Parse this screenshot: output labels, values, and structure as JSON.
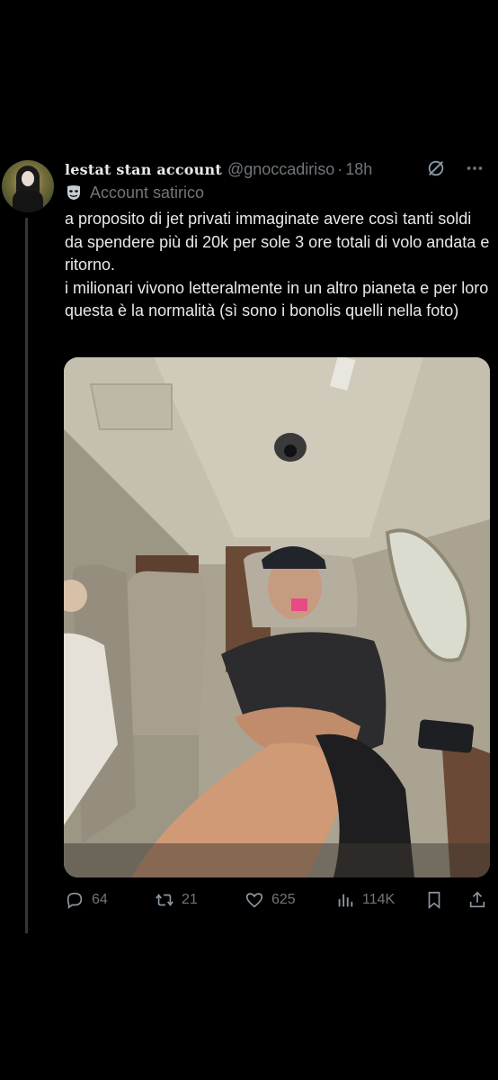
{
  "tweet": {
    "display_name": "lestat stan account",
    "handle": "@gnoccadiriso",
    "separator": "·",
    "time": "18h",
    "label": "Account satirico",
    "lines": [
      "a proposito di jet privati immaginate avere così tanti soldi da spendere più di 20k per sole 3 ore totali di volo andata e ritorno.",
      "i milionari vivono letteralmente in un altro pianeta e per loro questa è la normalità (sì sono i bonolis quelli nella foto)"
    ]
  },
  "icons": {
    "avatar": "avatar-gothic-portrait",
    "grok": "grok-icon",
    "more": "more-icon",
    "label": "mask-icon"
  },
  "actions": {
    "replies": "64",
    "reposts": "21",
    "likes": "625",
    "views": "114K"
  },
  "colors": {
    "background": "#000000",
    "text": "#e7e9ea",
    "muted": "#71767b",
    "thread_line": "#333639"
  }
}
